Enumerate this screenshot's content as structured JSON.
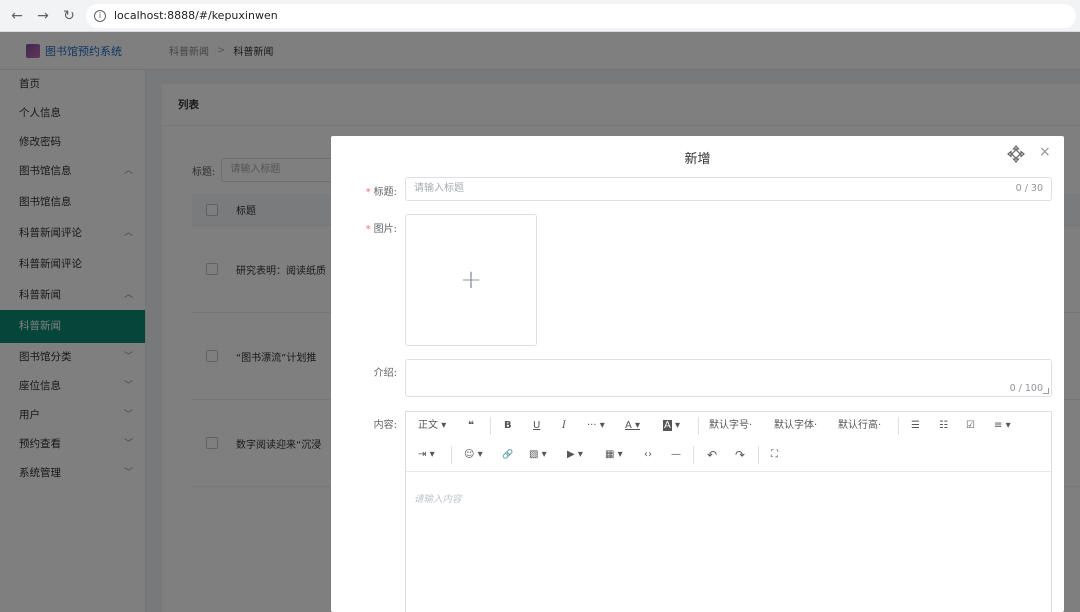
{
  "browser": {
    "url": "localhost:8888/#/kepuxinwen",
    "back": "←",
    "forward": "→",
    "reload": "↻",
    "info": "i"
  },
  "app": {
    "title": "图书馆预约系统",
    "breadcrumb": [
      "科普新闻",
      "科普新闻"
    ],
    "breadcrumb_sep": ">"
  },
  "sidebar": {
    "items": [
      {
        "label": "首页"
      },
      {
        "label": "个人信息"
      },
      {
        "label": "修改密码"
      },
      {
        "label": "图书馆信息",
        "chevron": "up"
      },
      {
        "label": "图书馆信息",
        "sub": true
      },
      {
        "label": "科普新闻评论",
        "chevron": "up"
      },
      {
        "label": "科普新闻评论",
        "sub": true
      },
      {
        "label": "科普新闻",
        "chevron": "up"
      },
      {
        "label": "科普新闻",
        "sub": true,
        "active": true
      },
      {
        "label": "图书馆分类",
        "chevron": "down"
      },
      {
        "label": "座位信息",
        "chevron": "down"
      },
      {
        "label": "用户",
        "chevron": "down"
      },
      {
        "label": "预约查看",
        "chevron": "down"
      },
      {
        "label": "系统管理",
        "chevron": "down"
      }
    ]
  },
  "list": {
    "card_title": "列表",
    "search_label": "标题:",
    "search_placeholder": "请输入标题",
    "column_title": "标题",
    "rows": [
      {
        "title": "研究表明：阅读纸质"
      },
      {
        "title": "“图书漂流”计划推"
      },
      {
        "title": "数字阅读迎来“沉浸"
      }
    ]
  },
  "dialog": {
    "title": "新增",
    "close": "×",
    "fields": {
      "title_label": "标题:",
      "title_placeholder": "请输入标题",
      "title_count": "0 / 30",
      "image_label": "图片:",
      "upload_plus": "+",
      "intro_label": "介绍:",
      "intro_count": "0 / 100",
      "content_label": "内容:",
      "content_placeholder": "请输入内容"
    },
    "toolbar": {
      "paragraph": "正文",
      "quote": "❝",
      "bold": "B",
      "underline": "U",
      "italic": "I",
      "more": "···",
      "font_color": "A",
      "bg_color": "A",
      "font_size": "默认字号",
      "font_family": "默认字体",
      "line_height": "默认行高",
      "bullet_list": "☰",
      "numbered_list": "☷",
      "todo": "☑",
      "align": "≡",
      "indent": "⇥",
      "emoji": "☺",
      "link": "🔗",
      "image": "▧",
      "video": "▶",
      "table": "▦",
      "code": "‹›",
      "divider": "—",
      "undo": "↶",
      "redo": "↷",
      "fullscreen": "⛶",
      "caret": "▾"
    }
  }
}
